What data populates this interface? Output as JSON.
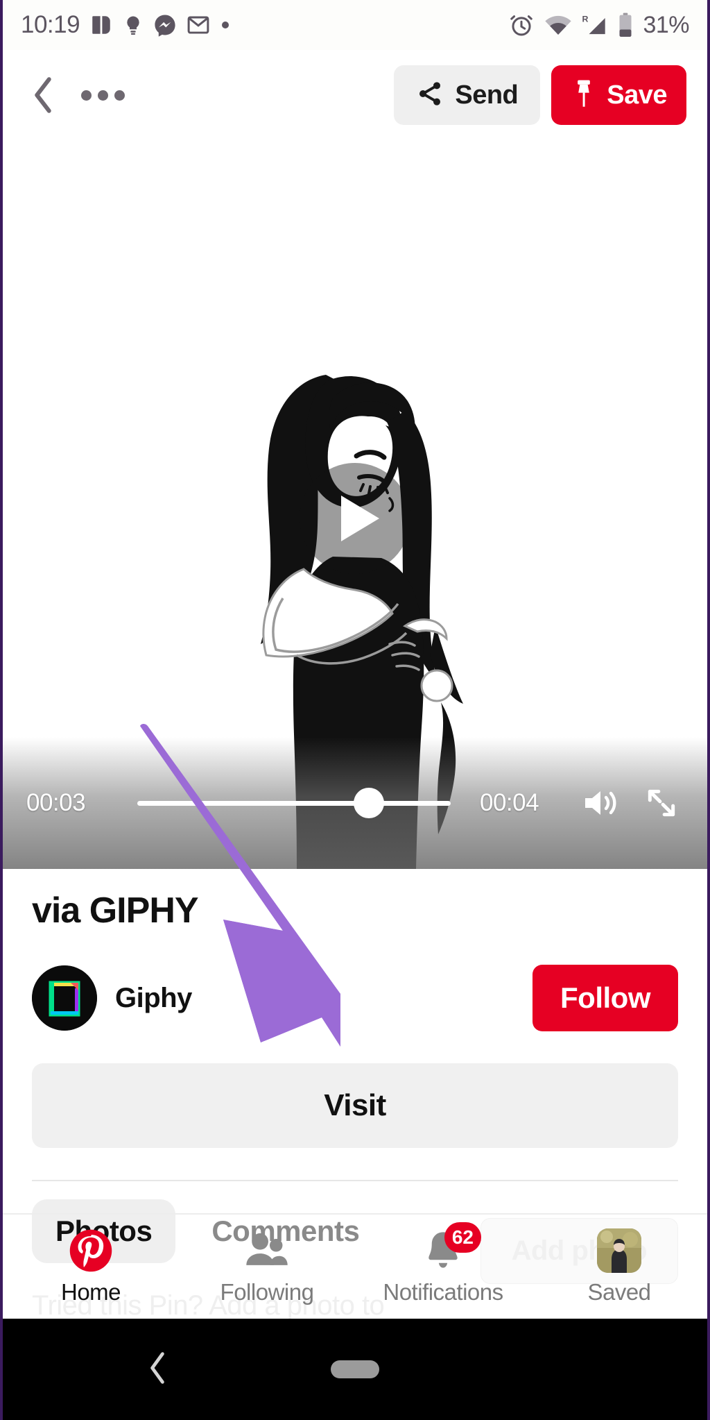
{
  "status_bar": {
    "time": "10:19",
    "left_icons": [
      "pocket-icon",
      "lightbulb-icon",
      "messenger-icon",
      "gmail-icon",
      "dot-icon"
    ],
    "right_icons": [
      "alarm-icon",
      "wifi-icon",
      "roaming-signal-icon",
      "battery-icon"
    ],
    "roaming_label": "R",
    "battery_percent": "31%"
  },
  "action_bar": {
    "back_icon": "chevron-left-icon",
    "overflow_icon": "more-horizontal-icon",
    "send_label": "Send",
    "send_icon": "share-icon",
    "save_label": "Save",
    "save_icon": "pin-icon"
  },
  "player": {
    "play_icon": "play-icon",
    "current_time": "00:03",
    "duration": "00:04",
    "progress_percent": 74,
    "volume_icon": "volume-on-icon",
    "fullscreen_icon": "expand-icon"
  },
  "details": {
    "pin_title": "via GIPHY",
    "creator_name": "Giphy",
    "creator_avatar": "giphy-logo",
    "follow_label": "Follow",
    "visit_label": "Visit",
    "tabs": [
      {
        "label": "Photos",
        "active": true
      },
      {
        "label": "Comments",
        "active": false
      }
    ],
    "tried_prompt": "Tried this Pin? Add a photo to show how it went",
    "add_photo_label": "Add photo"
  },
  "bottom_nav": {
    "items": [
      {
        "label": "Home",
        "icon": "pinterest-icon",
        "active": true,
        "badge": ""
      },
      {
        "label": "Following",
        "icon": "people-icon",
        "active": false,
        "badge": ""
      },
      {
        "label": "Notifications",
        "icon": "bell-icon",
        "active": false,
        "badge": "62"
      },
      {
        "label": "Saved",
        "icon": "profile-avatar",
        "active": false,
        "badge": ""
      }
    ]
  },
  "android_nav": {
    "back_icon": "nav-back-icon",
    "home_icon": "nav-home-pill"
  },
  "annotation": {
    "arrow_color": "#9b6bd6",
    "arrow_target": "visit-button"
  },
  "colors": {
    "brand_red": "#e60023",
    "button_grey": "#efefef",
    "text_dark": "#111111",
    "text_muted": "#8a8a8a"
  }
}
